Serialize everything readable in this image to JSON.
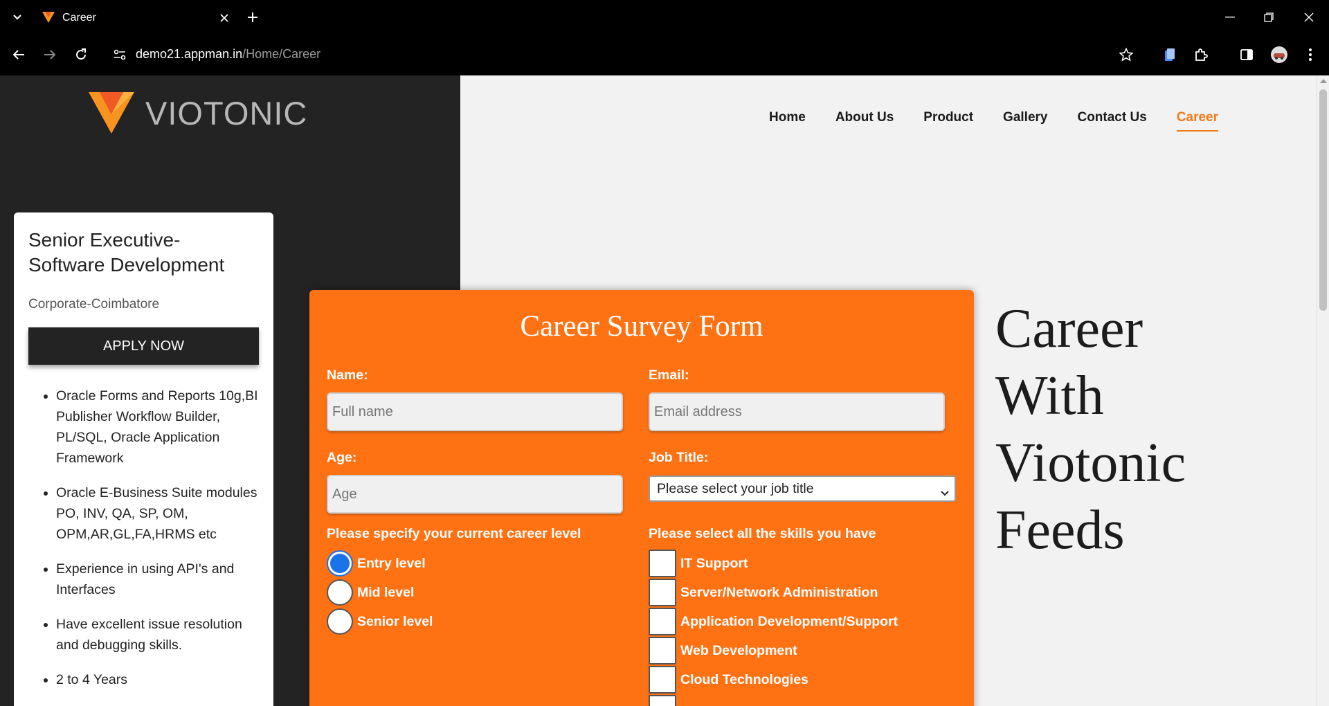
{
  "browser": {
    "tab_title": "Career",
    "url_host": "demo21.appman.in",
    "url_path": "/Home/Career"
  },
  "site": {
    "logo_text": "VIOTONIC",
    "nav": [
      {
        "label": "Home"
      },
      {
        "label": "About Us"
      },
      {
        "label": "Product"
      },
      {
        "label": "Gallery"
      },
      {
        "label": "Contact Us"
      },
      {
        "label": "Career",
        "active": true
      }
    ]
  },
  "job": {
    "title_line1": "Senior Executive-",
    "title_line2": "Software Development",
    "location": "Corporate-Coimbatore",
    "apply_label": "APPLY NOW",
    "requirements": [
      "Oracle Forms and Reports 10g,BI Publisher Workflow Builder, PL/SQL, Oracle Application Framework",
      "Oracle E-Business Suite modules PO, INV, QA, SP, OM, OPM,AR,GL,FA,HRMS etc",
      "Experience in using API's and Interfaces",
      "Have excellent issue resolution and debugging skills.",
      "2 to 4 Years"
    ]
  },
  "form": {
    "title": "Career Survey Form",
    "name_label": "Name:",
    "name_placeholder": "Full name",
    "email_label": "Email:",
    "email_placeholder": "Email address",
    "age_label": "Age:",
    "age_placeholder": "Age",
    "job_title_label": "Job Title:",
    "job_title_selected": "Please select your job title",
    "career_level_label": "Please specify your current career level",
    "career_levels": [
      {
        "label": "Entry level",
        "checked": true
      },
      {
        "label": "Mid level",
        "checked": false
      },
      {
        "label": "Senior level",
        "checked": false
      }
    ],
    "skills_label": "Please select all the skills you have",
    "skills": [
      {
        "label": "IT Support"
      },
      {
        "label": "Server/Network Administration"
      },
      {
        "label": "Application Development/Support"
      },
      {
        "label": "Web Development"
      },
      {
        "label": "Cloud Technologies"
      }
    ]
  },
  "hero": {
    "line1": "Career",
    "line2": "With",
    "line3": "Viotonic",
    "line4": "Feeds"
  },
  "colors": {
    "accent": "#ff7214",
    "nav_active": "#f07a1a",
    "dark_panel": "#232323",
    "radio_selected": "#1a73e8"
  }
}
